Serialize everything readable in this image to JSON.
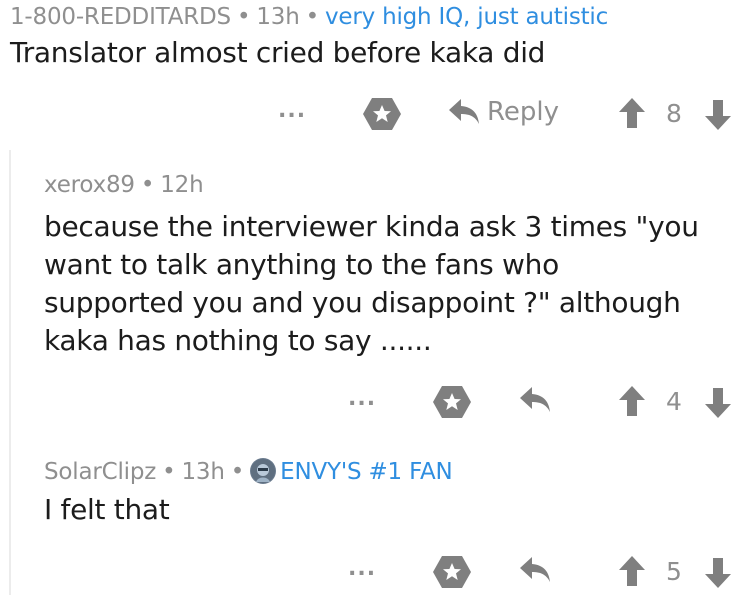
{
  "comments": [
    {
      "author": "1-800-REDDITARDS",
      "time": "13h",
      "flair": "very high IQ, just autistic",
      "body": "Translator almost cried before kaka did",
      "more": "...",
      "reply_label": "Reply",
      "score": "8"
    },
    {
      "author": "xerox89",
      "time": "12h",
      "body_lines": [
        "because the interviewer kinda ask 3 times \"you",
        "want to talk anything to the fans who",
        "supported you and you disappoint ?\" although",
        "kaka has nothing to say ......"
      ],
      "more": "...",
      "score": "4"
    },
    {
      "author": "SolarClipz",
      "time": "13h",
      "flair": "ENVY'S #1 FAN",
      "body": "I felt that",
      "more": "...",
      "score": "5"
    }
  ],
  "separator": "•",
  "colors": {
    "meta_gray": "#8f8f8f",
    "flair_blue": "#2f8ee0",
    "icon_gray": "#7f7f7f",
    "text": "#1c1c1c"
  },
  "icons": [
    "star-icon",
    "reply-arrow-icon",
    "upvote-icon",
    "downvote-icon",
    "more-icon",
    "flair-avatar-icon"
  ]
}
